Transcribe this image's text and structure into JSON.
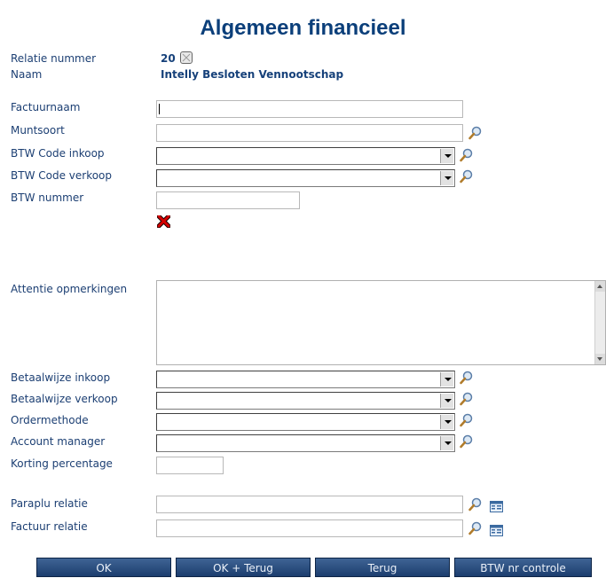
{
  "page": {
    "title": "Algemeen financieel"
  },
  "relatie": {
    "nummer_label": "Relatie nummer",
    "nummer_value": "20",
    "naam_label": "Naam",
    "naam_value": "Intelly Besloten Vennootschap"
  },
  "fields": {
    "factuurnaam": {
      "label": "Factuurnaam",
      "value": ""
    },
    "muntsoort": {
      "label": "Muntsoort",
      "value": ""
    },
    "btw_code_inkoop": {
      "label": "BTW Code inkoop",
      "value": ""
    },
    "btw_code_verkoop": {
      "label": "BTW Code verkoop",
      "value": ""
    },
    "btw_nummer": {
      "label": "BTW nummer",
      "value": ""
    },
    "attentie_opmerkingen": {
      "label": "Attentie opmerkingen",
      "value": ""
    },
    "betaalwijze_inkoop": {
      "label": "Betaalwijze inkoop",
      "value": ""
    },
    "betaalwijze_verkoop": {
      "label": "Betaalwijze verkoop",
      "value": ""
    },
    "ordermethode": {
      "label": "Ordermethode",
      "value": ""
    },
    "account_manager": {
      "label": "Account manager",
      "value": ""
    },
    "korting_percentage": {
      "label": "Korting percentage",
      "value": ""
    },
    "paraplu_relatie": {
      "label": "Paraplu relatie",
      "value": ""
    },
    "factuur_relatie": {
      "label": "Factuur relatie",
      "value": ""
    }
  },
  "buttons": {
    "ok": "OK",
    "ok_terug": "OK + Terug",
    "terug": "Terug",
    "btw_nr_controle": "BTW nr controle"
  },
  "icons": {
    "lookup": "magnifier-icon",
    "card": "card-icon",
    "invalid": "red-x-icon",
    "relatie_status": "checkbox-icon"
  },
  "colors": {
    "title": "#0b3f7a",
    "label": "#1c3f73",
    "button_bg": "#1c3d6e",
    "invalid": "#cc0000"
  }
}
